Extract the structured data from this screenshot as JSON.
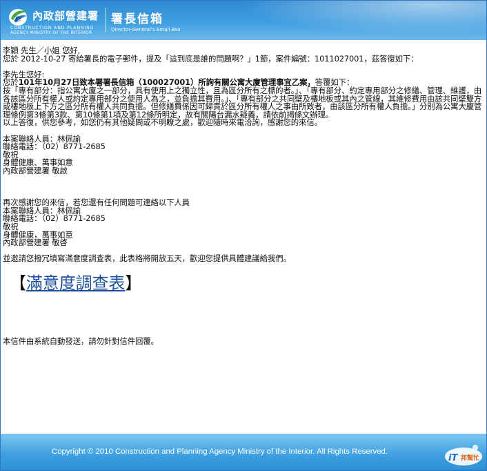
{
  "header": {
    "org_name": "內政部營建署",
    "org_en_line1": "CONSTRUCTION AND PLANNING",
    "org_en_line2": "AGENCY MINISTRY OF THE INTERIOR",
    "box_name": "署長信箱",
    "box_en": "Director-General's Email Box"
  },
  "letter": {
    "greeting": "李穎 先生／小姐 您好,",
    "intro": "您於 2012-10-27 寄給署長的電子郵件，提及「這到底是誰的問題啊？」1節，案件編號：1011027001，茲答復如下：",
    "reply_greeting": "李先生您好:",
    "reply_body_pre": "您於",
    "reply_body_bold": "101年10月27日致本署署長信箱（100027001）所詢有關公寓大廈管理事宜乙案，",
    "reply_body_post": "答覆如下：",
    "body_line": "按「專有部分：指公寓大廈之一部分，具有使用上之獨立性，且為區分所有之標的者。」、「專有部分、約定專用部分之修繕、管理、維護，由各該區分所有權人或約定專用部分之使用人為之，並負擔其費用。」、「專有部分之共同壁及樓地板或其內之管線，其維修費用由該共同壁雙方或樓地板上下方之區分所有權人共同負擔。但修繕費係因可歸責於區分所有權人之事由所致者，由該區分所有權人負擔。」分別為公寓大廈管理條例第3條第3款、第10條第1項及第12條所明定，故有關陽台漏水疑義，請依前揭條文辦理。",
    "closing_line": "以上答復，供您參考，如您仍有其他疑問或不明瞭之處，歡迎隨時來電洽詢，感謝您的來信。",
    "contact1_person": "本案聯絡人員：林佩諭",
    "contact1_phone": "聯絡電話：（02）8771-2685",
    "contact1_respect": "敬祝",
    "contact1_wish": "身體健康、萬事如意",
    "contact1_signature": "內政部營建署 敬啟",
    "thanks_line": "再次感謝您的來信，若您還有任何問題可連絡以下人員",
    "contact2_person": "本案聯絡人員：林佩諭",
    "contact2_phone": "聯絡電話：（02）8771-2685",
    "contact2_respect": "敬祝",
    "contact2_wish": "身體健康，萬事如意",
    "contact2_signature": "內政部營建署 敬啓",
    "survey_invite": "並邀請您撥冗填寫滿意度調查表，此表格將開放五天，歡迎您提供具體建議給我們。",
    "survey_bracket_open": "【",
    "survey_link": "滿意度調查表",
    "survey_bracket_close": "】",
    "auto_notice": "本信件由系統自動發送，請勿針對信件回覆。"
  },
  "footer": {
    "copyright": "Copyright © 2010 Construction and Planning Agency Ministry of the Interior.  All Rights Reserved.",
    "watermark_text": "iT邦幫忙"
  },
  "colors": {
    "header_blue": "#3f9ee0",
    "link_blue": "#1a4e9c",
    "logo_green": "#3caa3c"
  }
}
